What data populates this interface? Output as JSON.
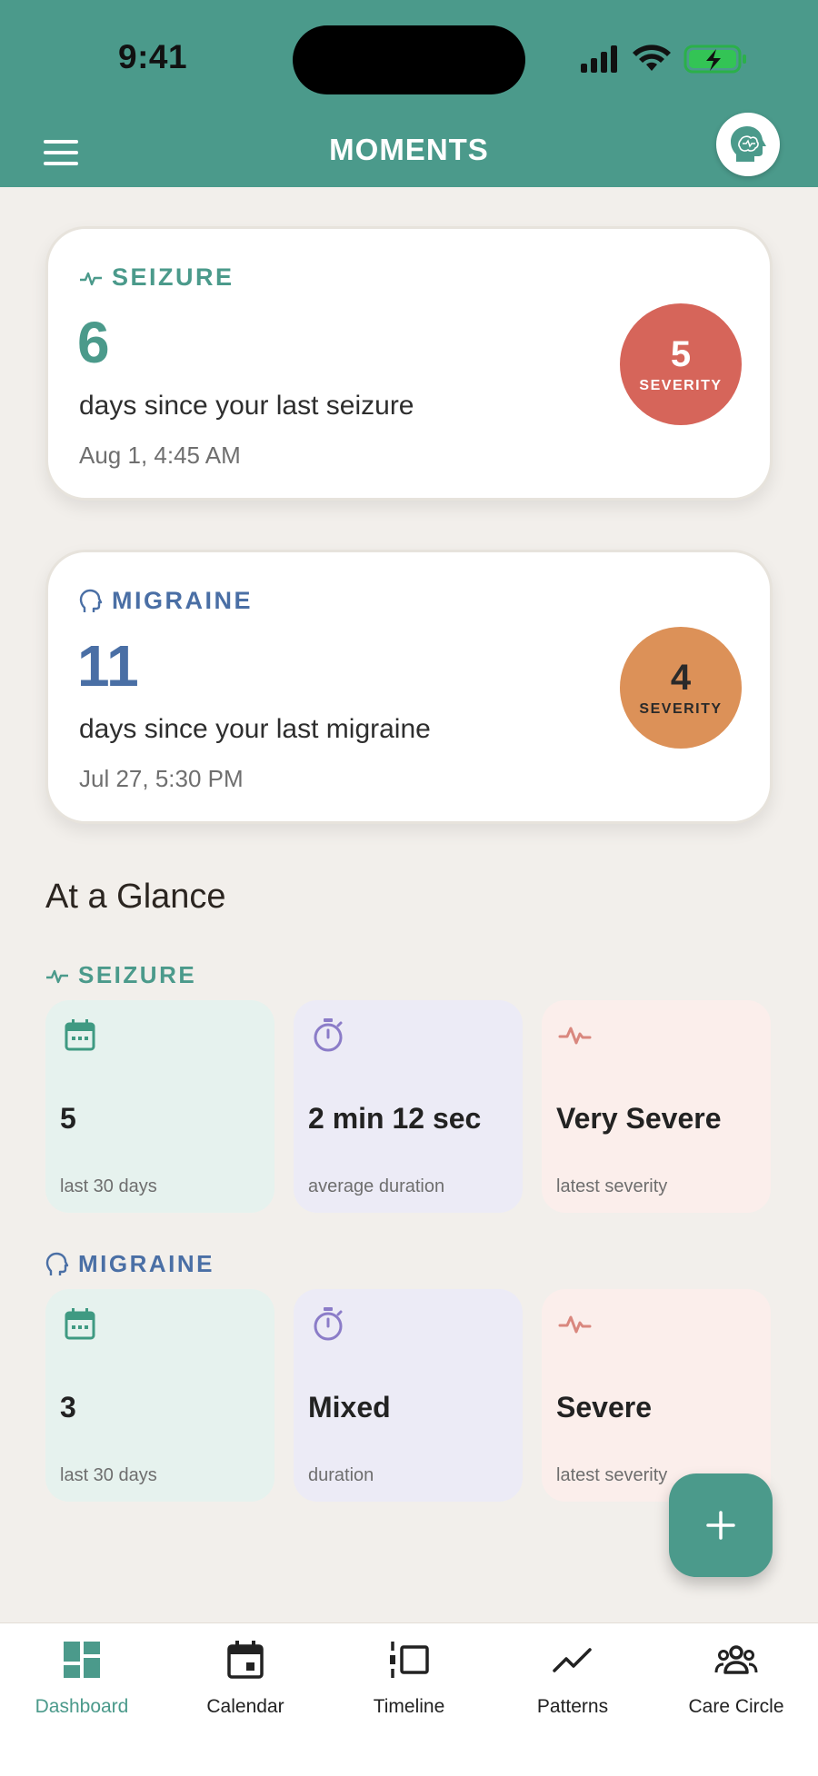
{
  "status_bar": {
    "time": "9:41"
  },
  "header": {
    "title": "MOMENTS"
  },
  "colors": {
    "teal": "#4b9a8b",
    "seizure_accent": "#4b9a8b",
    "migraine_accent": "#4a6fa5",
    "severity_5": "#d6655a",
    "severity_4": "#dc9158"
  },
  "moments": [
    {
      "type": "SEIZURE",
      "count": "6",
      "since_text": "days since your last seizure",
      "date": "Aug 1, 4:45 AM",
      "severity_value": "5",
      "severity_label": "SEVERITY"
    },
    {
      "type": "MIGRAINE",
      "count": "11",
      "since_text": "days since your last migraine",
      "date": "Jul 27, 5:30 PM",
      "severity_value": "4",
      "severity_label": "SEVERITY"
    }
  ],
  "glance": {
    "title": "At a Glance",
    "sections": [
      {
        "label": "SEIZURE",
        "tiles": [
          {
            "icon": "calendar-icon",
            "value": "5",
            "caption": "last 30 days"
          },
          {
            "icon": "stopwatch-icon",
            "value": "2 min 12 sec",
            "caption": "average duration"
          },
          {
            "icon": "pulse-icon",
            "value": "Very Severe",
            "caption": "latest severity"
          }
        ]
      },
      {
        "label": "MIGRAINE",
        "tiles": [
          {
            "icon": "calendar-icon",
            "value": "3",
            "caption": "last 30 days"
          },
          {
            "icon": "stopwatch-icon",
            "value": "Mixed",
            "caption": "duration"
          },
          {
            "icon": "pulse-icon",
            "value": "Severe",
            "caption": "latest severity"
          }
        ]
      }
    ]
  },
  "fab": {
    "icon": "plus-icon"
  },
  "tabs": [
    {
      "label": "Dashboard",
      "icon": "dashboard-icon",
      "active": true
    },
    {
      "label": "Calendar",
      "icon": "calendar-icon",
      "active": false
    },
    {
      "label": "Timeline",
      "icon": "timeline-icon",
      "active": false
    },
    {
      "label": "Patterns",
      "icon": "trend-icon",
      "active": false
    },
    {
      "label": "Care Circle",
      "icon": "people-icon",
      "active": false
    }
  ]
}
